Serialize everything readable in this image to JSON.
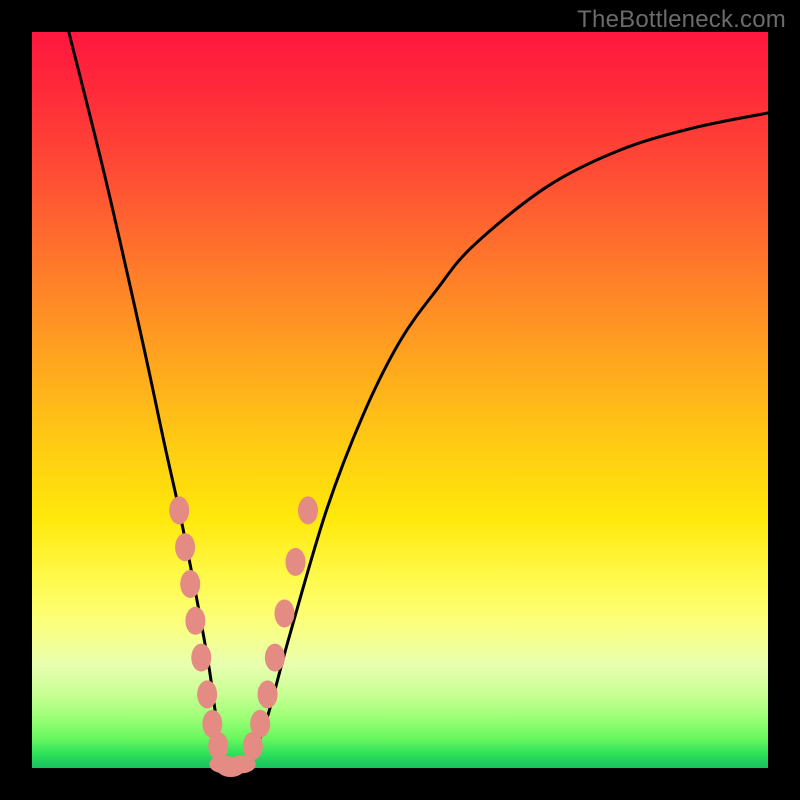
{
  "watermark": "TheBottleneck.com",
  "colors": {
    "background": "#000000",
    "curve": "#000000",
    "dot_fill": "#e48b84",
    "dot_stroke": "#c06a63",
    "gradient_top": "#ff173f",
    "gradient_bottom": "#17c05e"
  },
  "chart_data": {
    "type": "line",
    "title": "",
    "xlabel": "",
    "ylabel": "",
    "xlim": [
      0,
      100
    ],
    "ylim": [
      0,
      100
    ],
    "series": [
      {
        "name": "bottleneck-curve",
        "x": [
          5,
          10,
          15,
          18,
          20,
          22,
          24,
          25,
          26,
          27,
          28,
          30,
          32,
          35,
          40,
          45,
          50,
          55,
          60,
          70,
          80,
          90,
          100
        ],
        "y": [
          100,
          80,
          58,
          44,
          35,
          25,
          14,
          7,
          2,
          0,
          0,
          2,
          7,
          18,
          35,
          48,
          58,
          65,
          71,
          79,
          84,
          87,
          89
        ]
      }
    ],
    "markers": {
      "name": "highlighted-points",
      "x_left": [
        20.0,
        20.8,
        21.5,
        22.2,
        23.0,
        23.8,
        24.5,
        25.3
      ],
      "y_left": [
        35.0,
        30.0,
        25.0,
        20.0,
        15.0,
        10.0,
        6.0,
        3.0
      ],
      "x_bottom": [
        26.0,
        27.0,
        28.5
      ],
      "y_bottom": [
        0.5,
        0.0,
        0.5
      ],
      "x_right": [
        30.0,
        31.0,
        32.0,
        33.0,
        34.3,
        35.8,
        37.5
      ],
      "y_right": [
        3.0,
        6.0,
        10.0,
        15.0,
        21.0,
        28.0,
        35.0
      ]
    }
  }
}
